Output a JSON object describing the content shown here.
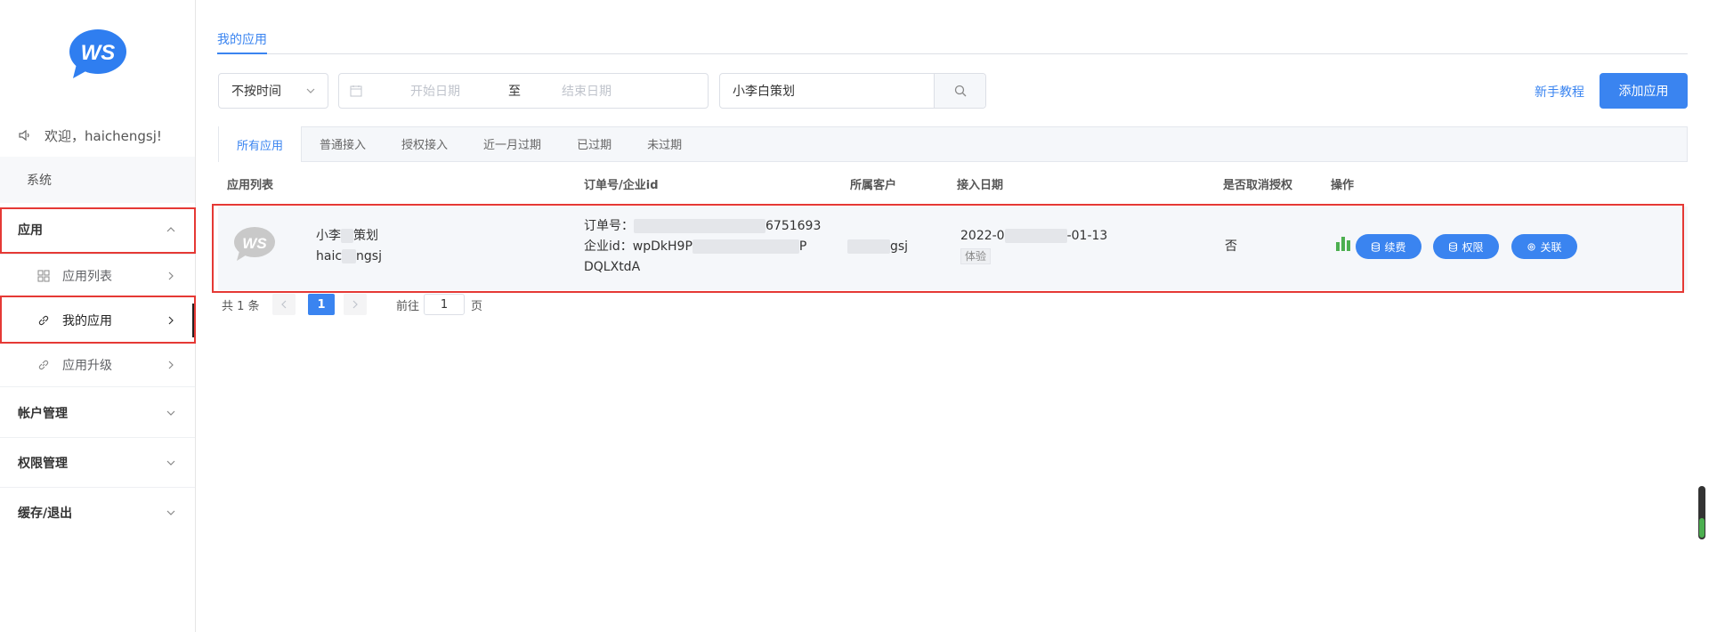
{
  "sidebar": {
    "logo_text": "WS",
    "welcome": "欢迎，haichengsj!",
    "system": "系统",
    "apps_group": "应用",
    "app_list": "应用列表",
    "my_apps": "我的应用",
    "app_upgrade": "应用升级",
    "account_mgmt": "帐户管理",
    "permission_mgmt": "权限管理",
    "cache_logout": "缓存/退出"
  },
  "main": {
    "page_tab": "我的应用",
    "time_filter": "不按时间",
    "date_start_placeholder": "开始日期",
    "date_separator": "至",
    "date_end_placeholder": "结束日期",
    "search_value": "小李白策划",
    "newbie_link": "新手教程",
    "add_button": "添加应用",
    "tabs": [
      "所有应用",
      "普通接入",
      "授权接入",
      "近一月过期",
      "已过期",
      "未过期"
    ],
    "columns": [
      "应用列表",
      "订单号/企业id",
      "所属客户",
      "接入日期",
      "是否取消授权",
      "操作"
    ]
  },
  "row": {
    "avatar_text": "WS",
    "name_line1_a": "小李",
    "name_line1_b": "策划",
    "name_line2_a": "haic",
    "name_line2_b": "ngsj",
    "order_label": "订单号：",
    "order_suffix": "6751693",
    "corp_label": "企业id：",
    "corp_prefix": "wpDkH9P",
    "corp_suffix": "P",
    "corp_line2": "DQLXtdA",
    "customer_suffix": "gsj",
    "date_prefix": "2022-0",
    "date_suffix": "-01-13",
    "date_tag": "体验",
    "revoked": "否",
    "btn_renew": "续费",
    "btn_permission": "权限",
    "btn_link": "关联"
  },
  "pager": {
    "total": "共 1 条",
    "current": "1",
    "goto": "前往",
    "page_value": "1",
    "page_unit": "页"
  },
  "colors": {
    "accent": "#3a84f0",
    "highlight_box": "#e53935",
    "chart_icon": "#4caf50"
  }
}
